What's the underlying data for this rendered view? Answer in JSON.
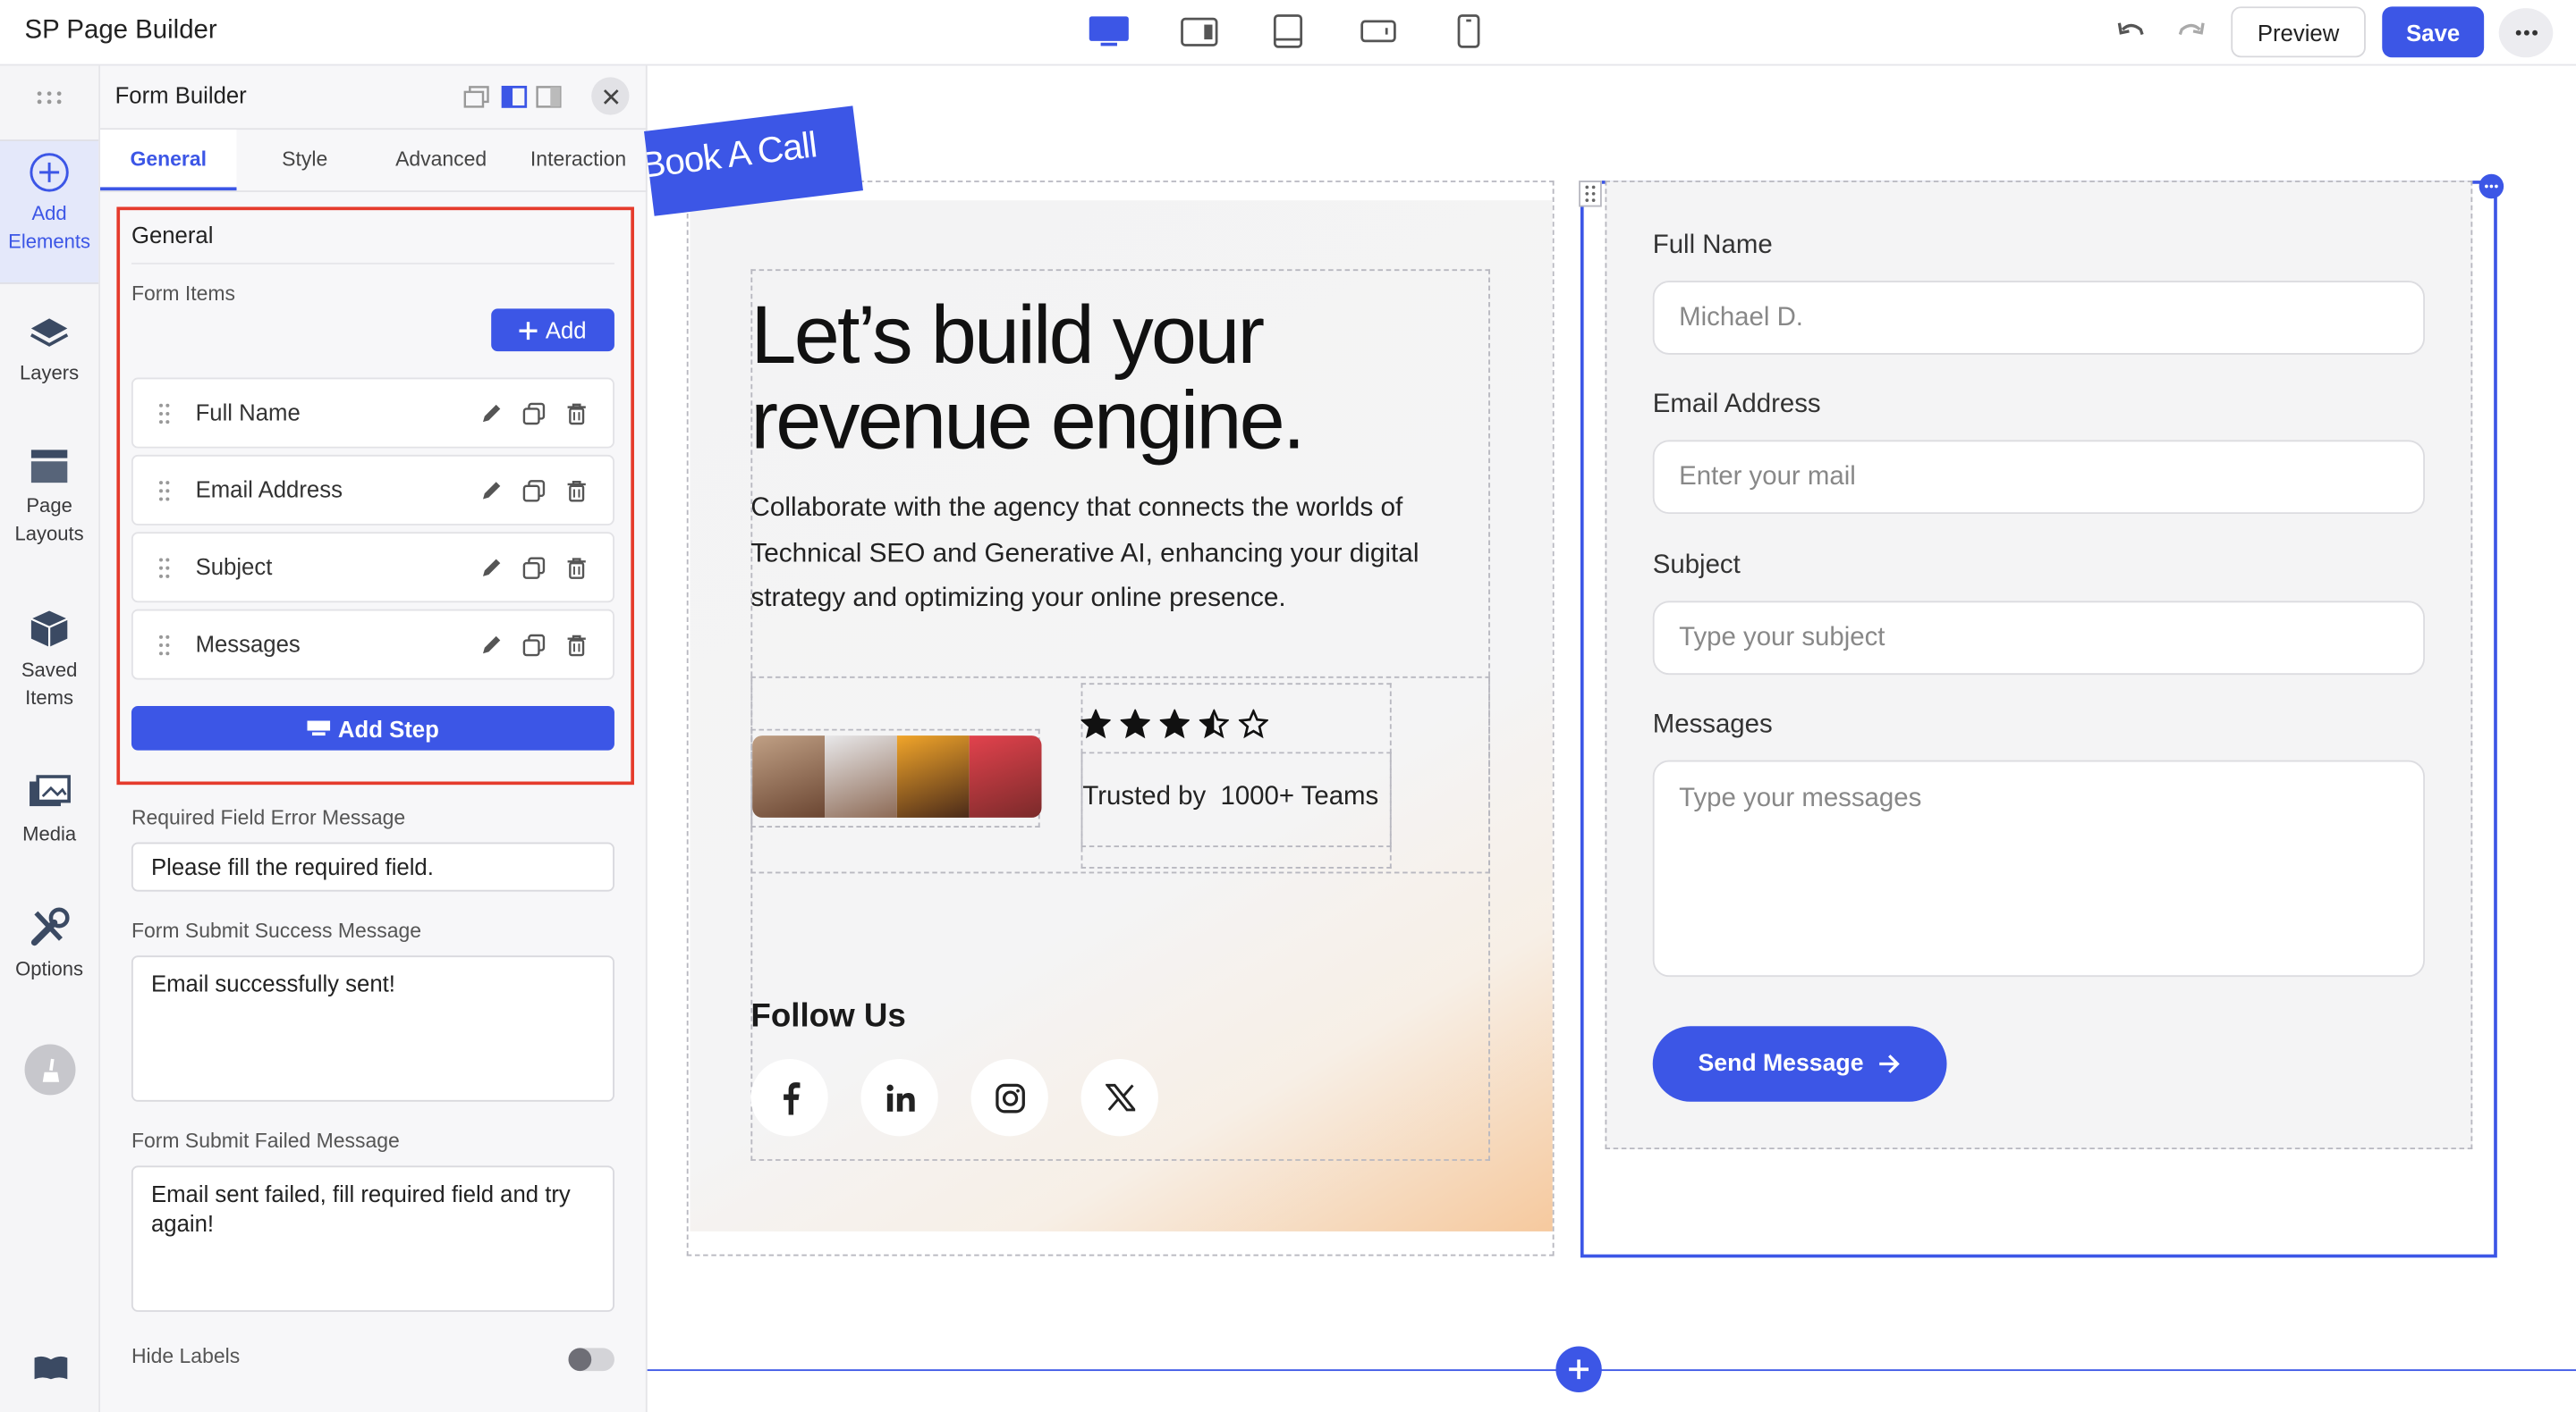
{
  "app": {
    "title": "SP Page Builder"
  },
  "toolbar": {
    "preview": "Preview",
    "save": "Save"
  },
  "rail": [
    {
      "label": "Add Elements",
      "icon": "plus-circle-icon"
    },
    {
      "label": "Layers",
      "icon": "layers-icon"
    },
    {
      "label": "Page Layouts",
      "icon": "page-layouts-icon"
    },
    {
      "label": "Saved Items",
      "icon": "saved-items-icon"
    },
    {
      "label": "Media",
      "icon": "media-icon"
    },
    {
      "label": "Options",
      "icon": "options-icon"
    }
  ],
  "panel": {
    "title": "Form Builder",
    "tabs": [
      "General",
      "Style",
      "Advanced",
      "Interaction"
    ],
    "section": "General",
    "form_items_label": "Form Items",
    "add_label": "Add",
    "items": [
      "Full Name",
      "Email Address",
      "Subject",
      "Messages"
    ],
    "add_step": "Add Step",
    "required_label": "Required Field Error Message",
    "required_value": "Please fill the required field.",
    "success_label": "Form Submit Success Message",
    "success_value": "Email successfully sent!",
    "failed_label": "Form Submit Failed Message",
    "failed_value": "Email sent failed, fill required field and try again!",
    "hide_labels": "Hide Labels",
    "hide_labels_on": false
  },
  "canvas": {
    "ribbon": "Book A Call",
    "heading": "Let’s build your revenue engine.",
    "paragraph": "Collaborate with the agency that connects the worlds of Technical SEO and Generative AI, enhancing your digital strategy and optimizing your online presence.",
    "rating": 3.5,
    "rating_max": 5,
    "trusted_prefix": "Trusted by",
    "trusted_count": "1000+ Teams",
    "follow": "Follow Us",
    "socials": [
      "facebook-icon",
      "linkedin-icon",
      "instagram-icon",
      "x-icon"
    ]
  },
  "form": {
    "fields": [
      {
        "label": "Full Name",
        "placeholder": "Michael D."
      },
      {
        "label": "Email Address",
        "placeholder": "Enter your mail"
      },
      {
        "label": "Subject",
        "placeholder": "Type your subject"
      },
      {
        "label": "Messages",
        "placeholder": "Type your messages"
      }
    ],
    "submit": "Send Message"
  },
  "colors": {
    "accent": "#3c56e6",
    "highlight": "#e53b2c"
  }
}
